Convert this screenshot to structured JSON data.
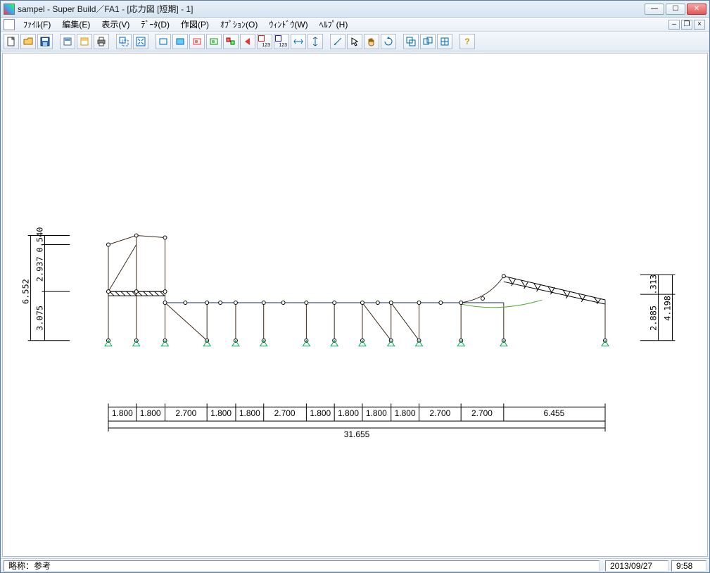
{
  "title": "sampel - Super Build／FA1 - [応力図 [短期] - 1]",
  "menu": {
    "file": "ﾌｧｲﾙ(F)",
    "edit": "編集(E)",
    "view": "表示(V)",
    "data": "ﾃﾞｰﾀ(D)",
    "draw": "作図(P)",
    "option": "ｵﾌﾟｼｮﾝ(O)",
    "window": "ｳｨﾝﾄﾞｳ(W)",
    "help": "ﾍﾙﾌﾟ(H)"
  },
  "status": {
    "label": "略称：参考",
    "date": "2013/09/27",
    "time": "9:58"
  },
  "dims": {
    "left": {
      "v1": "3.075",
      "v2": "2.937",
      "v3": "0.540",
      "total": "6.552"
    },
    "right": {
      "v1": "2.885",
      "v2": ".313",
      "total": "4.198"
    },
    "bottom": {
      "segs": [
        "1.800",
        "1.800",
        "2.700",
        "1.800",
        "1.800",
        "2.700",
        "1.800",
        "1.800",
        "1.800",
        "1.800",
        "2.700",
        "2.700",
        "6.455"
      ],
      "total": "31.655"
    }
  }
}
